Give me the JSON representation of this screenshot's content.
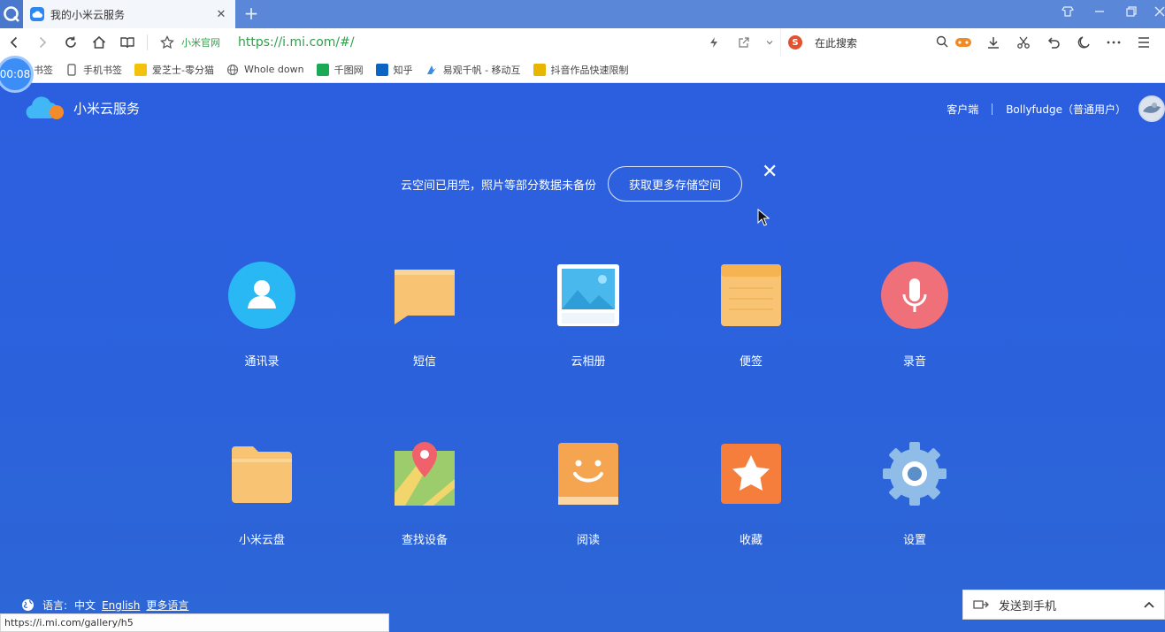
{
  "browser": {
    "tab_title": "我的小米云服务",
    "tab_close": "✕",
    "new_tab": "+",
    "site_label": "小米官网",
    "url": "https://i.mi.com/#/",
    "search_placeholder": "在此搜索",
    "status_url": "https://i.mi.com/gallery/h5",
    "timer": "00:08",
    "bookmarks": [
      {
        "label": "书签",
        "icon": "folder-icon"
      },
      {
        "label": "手机书签",
        "icon": "phone-icon"
      },
      {
        "label": "爱芝士-零分猫",
        "icon": "cat-icon"
      },
      {
        "label": "Whole down",
        "icon": "globe-icon"
      },
      {
        "label": "千图网",
        "icon": "qiantu-icon"
      },
      {
        "label": "知乎",
        "icon": "zhihu-icon"
      },
      {
        "label": "易观千帆 - 移动互",
        "icon": "analysys-icon"
      },
      {
        "label": "抖音作品快速限制",
        "icon": "douyin-icon"
      }
    ],
    "send_to_phone": "发送到手机"
  },
  "header": {
    "brand": "小米云服务",
    "client_link": "客户端",
    "user": "Bollyfudge（普通用户）"
  },
  "notice": {
    "text": "云空间已用完，照片等部分数据未备份",
    "button": "获取更多存储空间",
    "close": "✕"
  },
  "apps": [
    {
      "label": "通讯录",
      "icon": "contacts-icon"
    },
    {
      "label": "短信",
      "icon": "sms-icon"
    },
    {
      "label": "云相册",
      "icon": "gallery-icon"
    },
    {
      "label": "便签",
      "icon": "notes-icon"
    },
    {
      "label": "录音",
      "icon": "recorder-icon"
    },
    {
      "label": "小米云盘",
      "icon": "cloud-drive-icon"
    },
    {
      "label": "查找设备",
      "icon": "find-device-icon"
    },
    {
      "label": "阅读",
      "icon": "reading-icon"
    },
    {
      "label": "收藏",
      "icon": "favorites-icon"
    },
    {
      "label": "设置",
      "icon": "settings-icon"
    }
  ],
  "footer": {
    "language_label": "语言:",
    "current_language": "中文",
    "english": "English",
    "more_languages": "更多语言"
  },
  "colors": {
    "page_bg": "#2b62dc",
    "url_green": "#2fa24a",
    "contacts": "#2ab8f4",
    "sms": "#f8c474",
    "notes": "#f8c474",
    "recorder": "#f0707a",
    "reading": "#f5a550",
    "favorites": "#f57e3c",
    "settings": "#8fbde8"
  }
}
